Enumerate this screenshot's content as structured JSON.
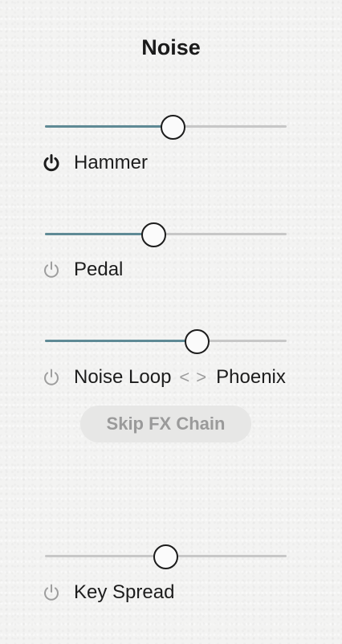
{
  "panel": {
    "title": "Noise"
  },
  "controls": [
    {
      "label": "Hammer",
      "value": 0.53,
      "active": true
    },
    {
      "label": "Pedal",
      "value": 0.45,
      "active": false
    },
    {
      "label": "Noise Loop",
      "value": 0.63,
      "active": false,
      "preset": "Phoenix",
      "prev_glyph": "<",
      "next_glyph": ">"
    },
    {
      "label": "Key Spread",
      "value": 0.5,
      "active": false
    }
  ],
  "skip_button": {
    "label": "Skip FX Chain"
  },
  "colors": {
    "slider_fill": "#5f8a95",
    "slider_track": "#c7c7c7",
    "power_on": "#1c1c1c",
    "power_off": "#9e9e9e"
  },
  "icons": {
    "power": "power-icon",
    "prev": "chevron-left-icon",
    "next": "chevron-right-icon"
  }
}
